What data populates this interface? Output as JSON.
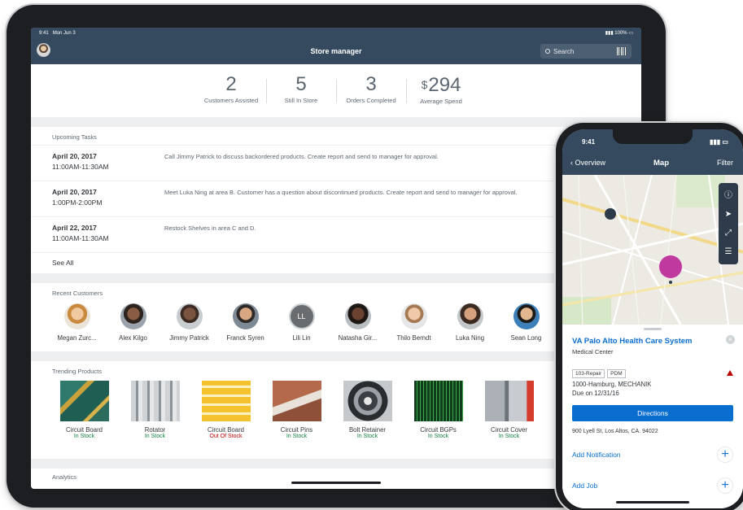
{
  "ipad": {
    "status": {
      "time": "9:41",
      "date": "Mon Jun 3",
      "battery": "100%"
    },
    "shell": {
      "title": "Store manager",
      "search_placeholder": "Search"
    },
    "kpis": [
      {
        "value": "2",
        "label": "Customers Assisted"
      },
      {
        "value": "5",
        "label": "Still In Store"
      },
      {
        "value": "3",
        "label": "Orders Completed"
      },
      {
        "currency": "$",
        "value": "294",
        "label": "Average Spend"
      }
    ],
    "tasks": {
      "header": "Upcoming Tasks",
      "items": [
        {
          "date": "April 20, 2017",
          "time": "11:00AM-11:30AM",
          "desc": "Call Jimmy Patrick to discuss backordered products. Create report and send to manager for approval."
        },
        {
          "date": "April 20, 2017",
          "time": "1:00PM-2:00PM",
          "desc": "Meet Luka Ning at area B. Customer has a question about discontinued products. Create report and send to manager for approval."
        },
        {
          "date": "April 22, 2017",
          "time": "11:00AM-11:30AM",
          "desc": "Restock Shelves in area C and D."
        }
      ],
      "see_all": "See All"
    },
    "customers": {
      "header": "Recent Customers",
      "items": [
        {
          "name": "Megan Zurc...",
          "initials": ""
        },
        {
          "name": "Alex Kilgo",
          "initials": ""
        },
        {
          "name": "Jimmy Patrick",
          "initials": ""
        },
        {
          "name": "Franck Syren",
          "initials": ""
        },
        {
          "name": "Lili Lin",
          "initials": "LL"
        },
        {
          "name": "Natasha Gir...",
          "initials": ""
        },
        {
          "name": "Thilo Berndt",
          "initials": ""
        },
        {
          "name": "Luka Ning",
          "initials": ""
        },
        {
          "name": "Sean Long",
          "initials": ""
        }
      ]
    },
    "products": {
      "header": "Trending Products",
      "items": [
        {
          "name": "Circuit Board",
          "status": "In Stock",
          "in_stock": true
        },
        {
          "name": "Rotator",
          "status": "In Stock",
          "in_stock": true
        },
        {
          "name": "Circuit Board",
          "status": "Out Of Stock",
          "in_stock": false
        },
        {
          "name": "Circuit Pins",
          "status": "In Stock",
          "in_stock": true
        },
        {
          "name": "Bolt Retainer",
          "status": "In Stock",
          "in_stock": true
        },
        {
          "name": "Circuit BGPs",
          "status": "In Stock",
          "in_stock": true
        },
        {
          "name": "Circuit Cover",
          "status": "In Stock",
          "in_stock": true
        }
      ]
    },
    "analytics": {
      "header": "Analytics"
    }
  },
  "iphone": {
    "status": {
      "time": "9:41"
    },
    "nav": {
      "back": "Overview",
      "title": "Map",
      "filter": "Filter"
    },
    "detail": {
      "title": "VA Palo Alto Health Care System",
      "subtitle": "Medical Center",
      "tags": [
        "103-Repair",
        "PDM"
      ],
      "line1": "1000-Hamburg, MECHANIK",
      "due": "Due on 12/31/16",
      "directions": "Directions",
      "address": "900 Lyell St, Los Altos, CA. 94022"
    },
    "actions": [
      {
        "label": "Add Notification"
      },
      {
        "label": "Add Job"
      }
    ]
  },
  "colors": {
    "shell": "#354a5f",
    "accent": "#0a6ed1",
    "positive": "#107e3e",
    "negative": "#bb0000"
  }
}
